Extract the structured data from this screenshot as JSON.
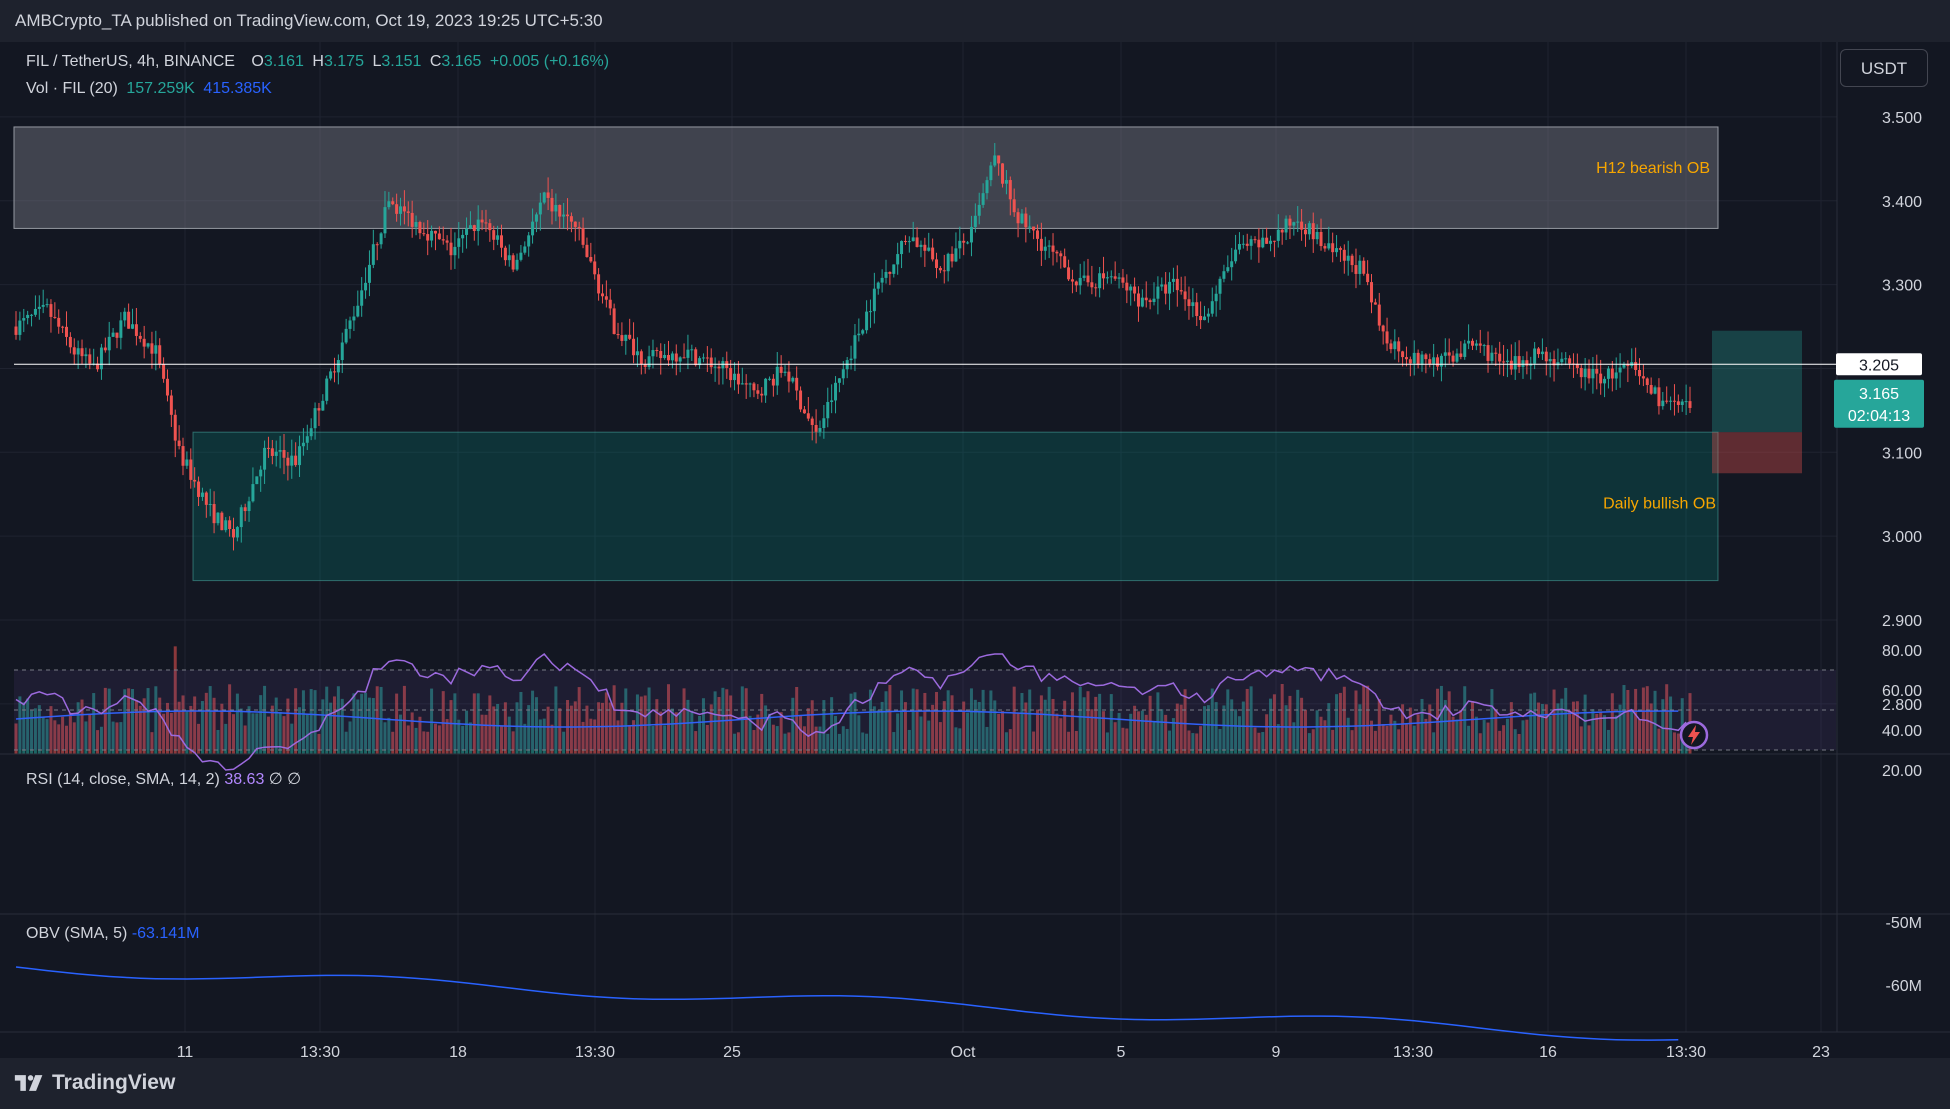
{
  "header": {
    "publisher": "AMBCrypto_TA published on TradingView.com, Oct 19, 2023 19:25 UTC+5:30"
  },
  "legend": {
    "symbol": "FIL / TetherUS, 4h, BINANCE",
    "o_label": "O",
    "o_val": "3.161",
    "h_label": "H",
    "h_val": "3.175",
    "l_label": "L",
    "l_val": "3.151",
    "c_label": "C",
    "c_val": "3.165",
    "change": "+0.005 (+0.16%)",
    "vol_label": "Vol · FIL (20)",
    "vol_val": "157.259K",
    "vol_ma": "415.385K"
  },
  "currency": "USDT",
  "rsi": {
    "label": "RSI (14, close, SMA, 14, 2)",
    "value": "38.63",
    "extra": "∅ ∅"
  },
  "obv": {
    "label": "OBV (SMA, 5)",
    "value": "-63.141M"
  },
  "footer": {
    "brand": "TradingView"
  },
  "colors": {
    "up": "#26a69a",
    "down": "#ef5350",
    "bg": "#131722",
    "vol_ma": "#2962ff",
    "rsi": "#9c6ade",
    "obv": "#2962ff",
    "annotation": "#f7a600"
  },
  "chart_data": {
    "type": "candlestick",
    "price_axis": [
      "3.500",
      "3.400",
      "3.300",
      "3.200",
      "3.100",
      "3.000",
      "2.900",
      "2.800"
    ],
    "price_range": [
      2.735,
      3.59
    ],
    "x_ticks": [
      "11",
      "13:30",
      "18",
      "13:30",
      "25",
      "Oct",
      "5",
      "9",
      "13:30",
      "16",
      "13:30",
      "23"
    ],
    "last_price": "3.165",
    "countdown": "02:04:13",
    "horizontal_line": "3.205",
    "zones": [
      {
        "label": "H12 bearish OB",
        "top": 3.488,
        "bottom": 3.367
      },
      {
        "label": "Daily bullish OB",
        "top": 3.124,
        "bottom": 2.947
      }
    ],
    "rsi_axis": [
      "80.00",
      "60.00",
      "40.00",
      "20.00"
    ],
    "obv_axis": [
      "-50M",
      "-60M"
    ],
    "candles_estimated": true
  }
}
